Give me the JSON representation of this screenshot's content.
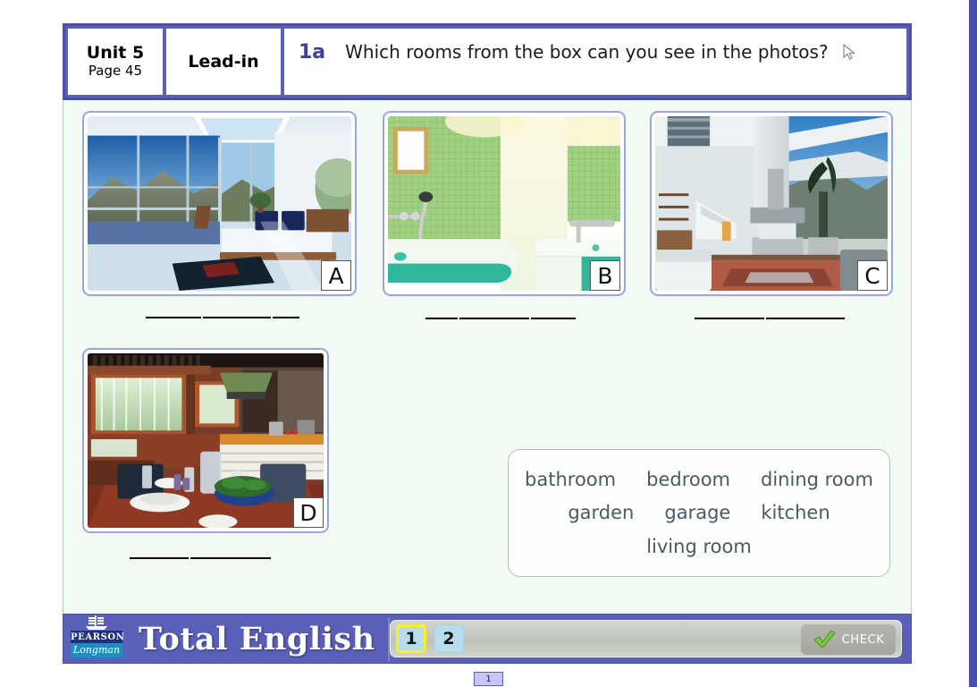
{
  "header": {
    "unit_title": "Unit 5",
    "unit_page": "Page 45",
    "section_label": "Lead-in",
    "question_number": "1a",
    "question_text": "Which rooms from the box can you see in the photos?",
    "cursor_icon": "mouse-pointer-icon"
  },
  "photos": [
    {
      "letter": "A",
      "alt": "bedroom with floor-to-ceiling windows and mountain view"
    },
    {
      "letter": "B",
      "alt": "green tiled bathroom with bathtub and basin"
    },
    {
      "letter": "C",
      "alt": "modern double-height living room with fireplace"
    },
    {
      "letter": "D",
      "alt": "kitchen and dining table with wooden interior"
    }
  ],
  "answer_blanks": [
    {
      "for": "A",
      "segments": 3
    },
    {
      "for": "B",
      "segments": 3
    },
    {
      "for": "C",
      "segments": 2
    },
    {
      "for": "D",
      "segments": 2
    }
  ],
  "word_box": {
    "rows": [
      [
        "bathroom",
        "bedroom",
        "dining room"
      ],
      [
        "garden",
        "garage",
        "kitchen"
      ],
      [
        "living room"
      ]
    ]
  },
  "footer": {
    "brand_publisher": "PEARSON",
    "brand_imprint": "Longman",
    "brand_title": "Total English",
    "ship_icon": "ship-icon",
    "nav_steps": [
      {
        "label": "1",
        "active": true
      },
      {
        "label": "2",
        "active": false
      }
    ],
    "check_label": "CHECK",
    "check_icon": "green-check-icon"
  },
  "page_indicator": {
    "label": "1"
  },
  "colors": {
    "frame_blue": "#5a5fb8",
    "frame_blue_dark": "#4a4fae",
    "content_mint": "#f2fbf1",
    "question_number_blue": "#3b4196",
    "word_text": "#4a5a63",
    "active_step_outline": "#ffef29",
    "check_green": "#7ac943"
  }
}
